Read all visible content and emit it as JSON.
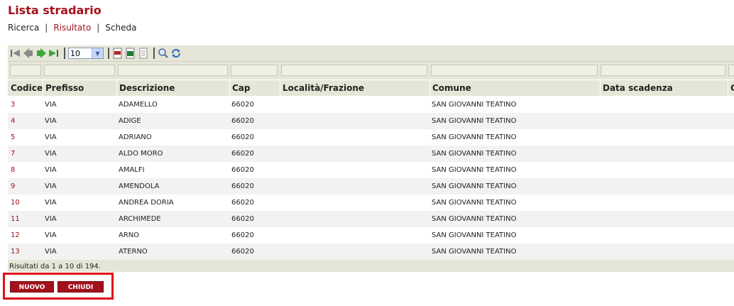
{
  "page_title": "Lista stradario",
  "nav": {
    "ricerca": "Ricerca",
    "sep1": "|",
    "risultato": "Risultato",
    "sep2": "|",
    "scheda": "Scheda"
  },
  "toolbar": {
    "page_size": "10"
  },
  "columns": [
    "Codice",
    "Prefisso",
    "Descrizione",
    "Cap",
    "Località/Frazione",
    "Comune",
    "Data scadenza",
    "C"
  ],
  "rows": [
    {
      "codice": "3",
      "prefisso": "VIA",
      "descrizione": "ADAMELLO",
      "cap": "66020",
      "localita": "",
      "comune": "SAN GIOVANNI TEATINO",
      "scadenza": ""
    },
    {
      "codice": "4",
      "prefisso": "VIA",
      "descrizione": "ADIGE",
      "cap": "66020",
      "localita": "",
      "comune": "SAN GIOVANNI TEATINO",
      "scadenza": ""
    },
    {
      "codice": "5",
      "prefisso": "VIA",
      "descrizione": "ADRIANO",
      "cap": "66020",
      "localita": "",
      "comune": "SAN GIOVANNI TEATINO",
      "scadenza": ""
    },
    {
      "codice": "7",
      "prefisso": "VIA",
      "descrizione": "ALDO MORO",
      "cap": "66020",
      "localita": "",
      "comune": "SAN GIOVANNI TEATINO",
      "scadenza": ""
    },
    {
      "codice": "8",
      "prefisso": "VIA",
      "descrizione": "AMALFI",
      "cap": "66020",
      "localita": "",
      "comune": "SAN GIOVANNI TEATINO",
      "scadenza": ""
    },
    {
      "codice": "9",
      "prefisso": "VIA",
      "descrizione": "AMENDOLA",
      "cap": "66020",
      "localita": "",
      "comune": "SAN GIOVANNI TEATINO",
      "scadenza": ""
    },
    {
      "codice": "10",
      "prefisso": "VIA",
      "descrizione": "ANDREA DORIA",
      "cap": "66020",
      "localita": "",
      "comune": "SAN GIOVANNI TEATINO",
      "scadenza": ""
    },
    {
      "codice": "11",
      "prefisso": "VIA",
      "descrizione": "ARCHIMEDE",
      "cap": "66020",
      "localita": "",
      "comune": "SAN GIOVANNI TEATINO",
      "scadenza": ""
    },
    {
      "codice": "12",
      "prefisso": "VIA",
      "descrizione": "ARNO",
      "cap": "66020",
      "localita": "",
      "comune": "SAN GIOVANNI TEATINO",
      "scadenza": ""
    },
    {
      "codice": "13",
      "prefisso": "VIA",
      "descrizione": "ATERNO",
      "cap": "66020",
      "localita": "",
      "comune": "SAN GIOVANNI TEATINO",
      "scadenza": ""
    }
  ],
  "results_info": "Risultati da 1 a 10 di 194.",
  "buttons": {
    "nuovo": "NUOVO",
    "chiudi": "CHIUDI"
  },
  "colors": {
    "accent": "#a3121c",
    "highlight_box": "#e0101a",
    "toolbar_bg": "#e6e6d8"
  }
}
